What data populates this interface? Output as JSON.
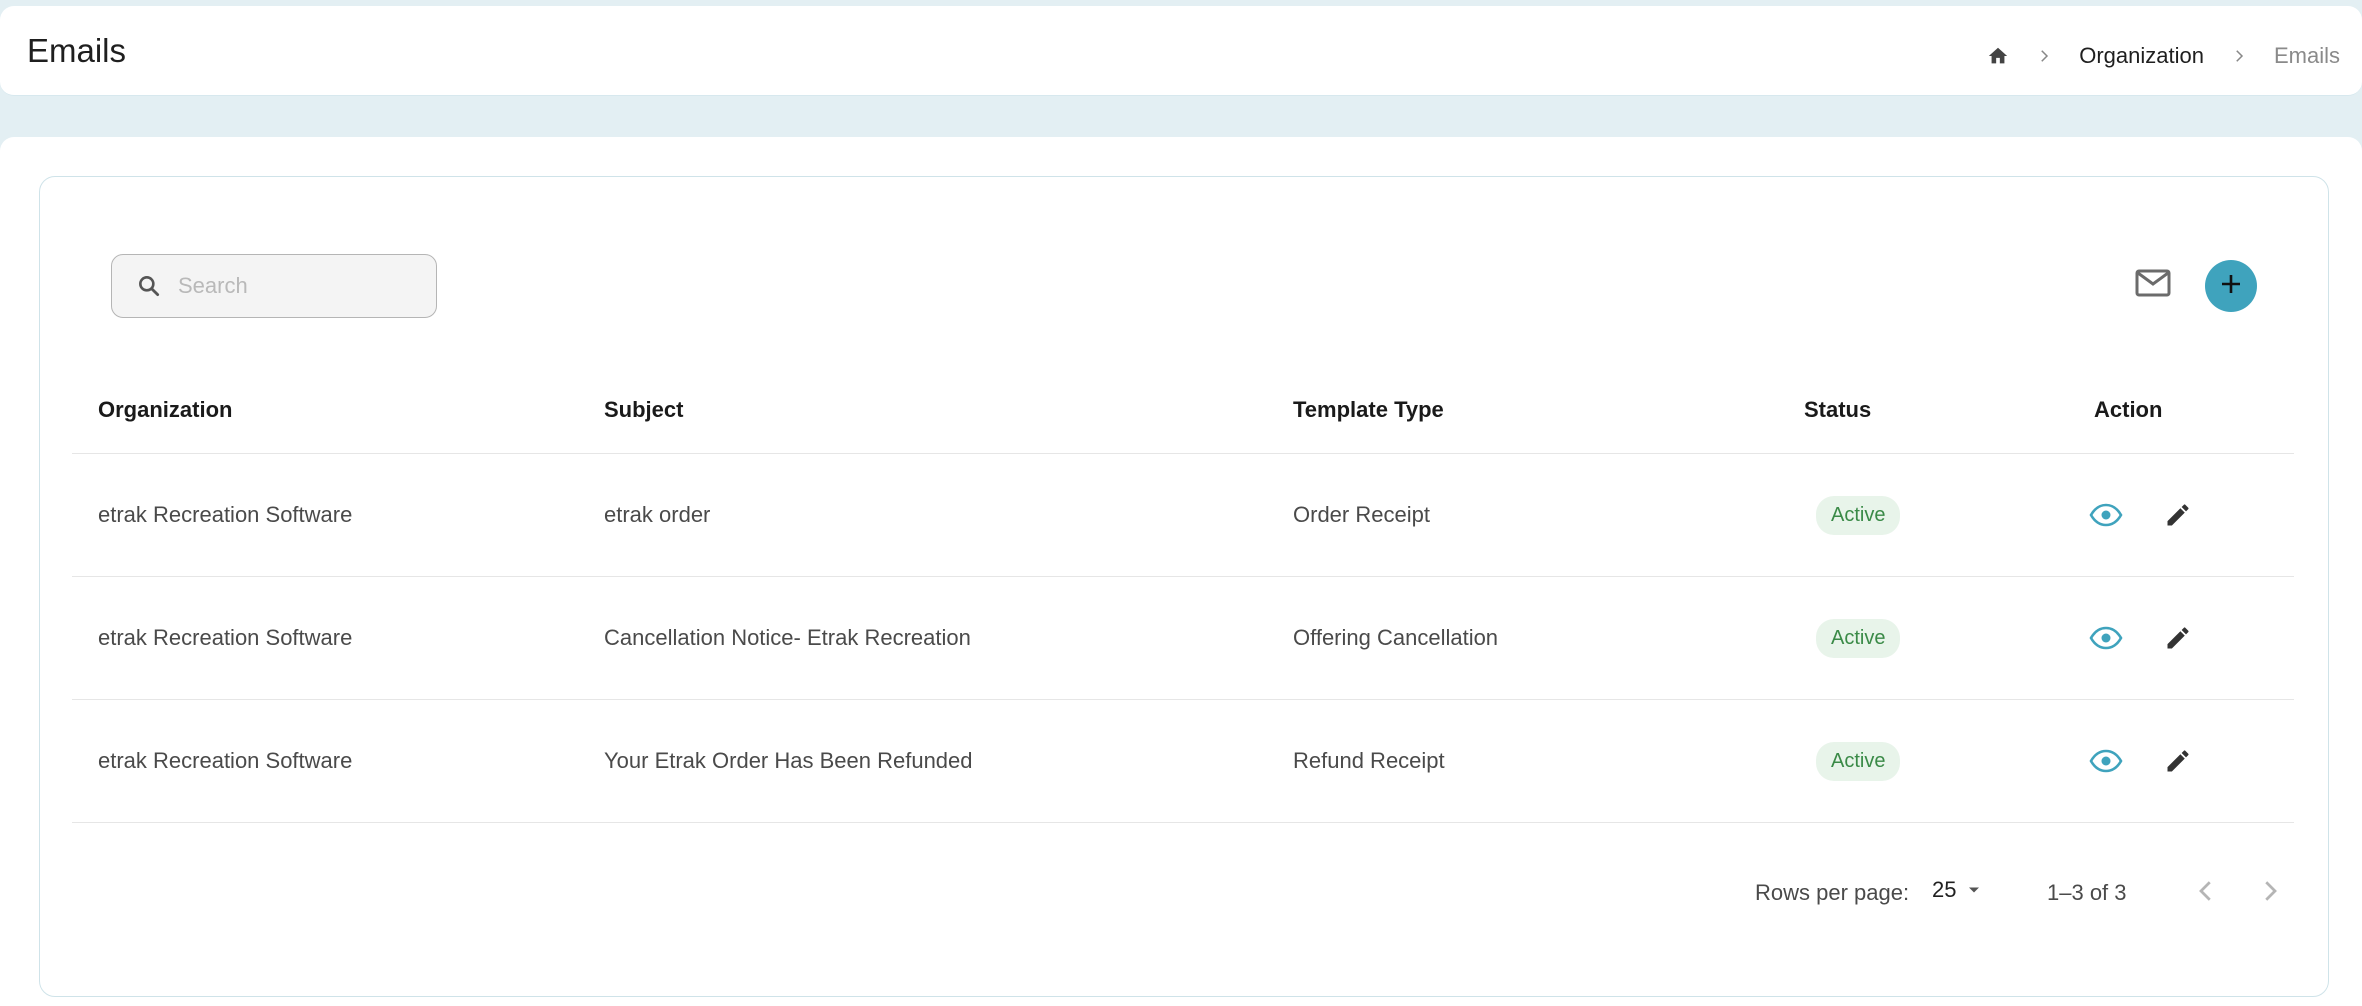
{
  "header": {
    "title": "Emails",
    "breadcrumb": {
      "home_icon": "home-icon",
      "items": [
        "Organization",
        "Emails"
      ]
    }
  },
  "toolbar": {
    "search_placeholder": "Search",
    "mail_icon": "mail-icon",
    "add_icon": "plus-icon",
    "accent_color": "#3fa3bd"
  },
  "table": {
    "columns": [
      "Organization",
      "Subject",
      "Template Type",
      "Status",
      "Action"
    ],
    "rows": [
      {
        "organization": "etrak Recreation Software",
        "subject": "etrak order",
        "template_type": "Order Receipt",
        "status": "Active"
      },
      {
        "organization": "etrak Recreation Software",
        "subject": "Cancellation Notice- Etrak Recreation",
        "template_type": "Offering Cancellation",
        "status": "Active"
      },
      {
        "organization": "etrak Recreation Software",
        "subject": "Your Etrak Order Has Been Refunded",
        "template_type": "Refund Receipt",
        "status": "Active"
      }
    ],
    "status_color": "#3a8a47",
    "status_bg": "#e8f4ea"
  },
  "pagination": {
    "rows_per_page_label": "Rows per page:",
    "rows_per_page_value": "25",
    "range": "1–3 of 3"
  }
}
